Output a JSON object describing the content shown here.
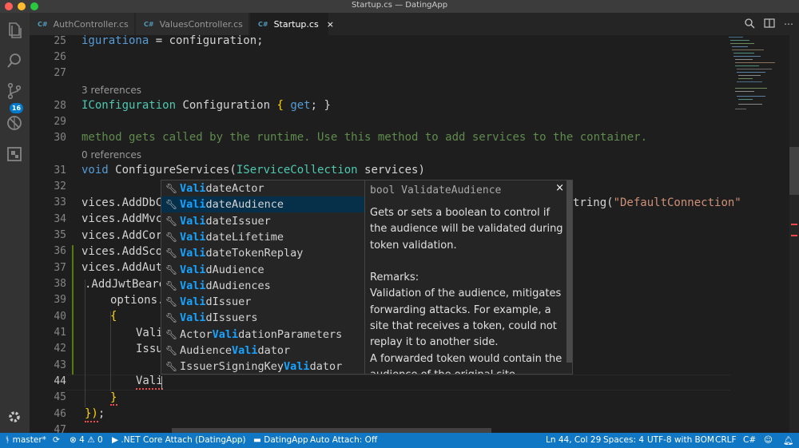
{
  "window": {
    "title": "Startup.cs — DatingApp"
  },
  "activity_bar": {
    "scm_badge": "16"
  },
  "tabs": [
    {
      "icon": "C#",
      "label": "AuthController.cs"
    },
    {
      "icon": "C#",
      "label": "ValuesController.cs"
    },
    {
      "icon": "C#",
      "label": "Startup.cs",
      "close": "×"
    }
  ],
  "editor": {
    "gutter": [
      "25",
      "26",
      "27",
      "28",
      "29",
      "30",
      "31",
      "32",
      "33",
      "34",
      "35",
      "36",
      "37",
      "38",
      "39",
      "40",
      "41",
      "42",
      "43",
      "44",
      "45",
      "46",
      "47"
    ],
    "codelens_28": "3 references",
    "codelens_31": "0 references",
    "lines": {
      "l25": "igurationа = configuration;",
      "l25_a": "igurationа",
      "l25_b": " = configuration;",
      "l28_type": "IConfiguration",
      "l28_mid": " Configuration ",
      "l28_b1": "{ ",
      "l28_get": "get",
      "l28_b2": "; }",
      "l30": "method gets called by the runtime. Use this method to add services to the container.",
      "l31_kw": "void",
      "l31_mid": " ConfigureServices(",
      "l31_type": "IServiceCollection",
      "l31_end": " services)",
      "l33": "vices.AddDbCo",
      "l33_right_a": "tring(",
      "l33_right_str": "\"DefaultConnection\"",
      "l34": "vices.AddMvc(",
      "l35": "vices.AddCors",
      "l36": "vices.AddScop",
      "l37": "vices.AddAuth",
      "l38": ".AddJwtBeare",
      "l39": "options.",
      "l40": "{",
      "l41": "Vali",
      "l42": "Issu",
      "l44": "Vali",
      "l45": "}",
      "l46_a": "})",
      "l46_b": ";"
    }
  },
  "suggest": {
    "items": [
      {
        "pre": "",
        "hl": "Vali",
        "post": "dateActor"
      },
      {
        "pre": "",
        "hl": "Vali",
        "post": "dateAudience"
      },
      {
        "pre": "",
        "hl": "Vali",
        "post": "dateIssuer"
      },
      {
        "pre": "",
        "hl": "Vali",
        "post": "dateLifetime"
      },
      {
        "pre": "",
        "hl": "Vali",
        "post": "dateTokenReplay"
      },
      {
        "pre": "",
        "hl": "Vali",
        "post": "dAudience"
      },
      {
        "pre": "",
        "hl": "Vali",
        "post": "dAudiences"
      },
      {
        "pre": "",
        "hl": "Vali",
        "post": "dIssuer"
      },
      {
        "pre": "",
        "hl": "Vali",
        "post": "dIssuers"
      },
      {
        "pre": "Actor",
        "hl": "Vali",
        "post": "dationParameters"
      },
      {
        "pre": "Audience",
        "hl": "Vali",
        "post": "dator"
      },
      {
        "pre": "IssuerSigningKey",
        "hl": "Vali",
        "post": "dator"
      }
    ],
    "selected_index": 1
  },
  "details": {
    "signature": "bool ValidateAudience",
    "close": "×",
    "summary": "Gets or sets a boolean to control if the audience will be validated during token validation.",
    "remarks_heading": "Remarks:",
    "remarks_1": "Validation of the audience, mitigates forwarding attacks. For example, a site that receives a token, could not replay it to another side.",
    "remarks_2": "A forwarded token would contain the audience of the original site."
  },
  "status_bar": {
    "branch": "master*",
    "errors": "4",
    "warnings": "0",
    "debug": ".NET Core Attach (DatingApp)",
    "folder": "DatingApp",
    "auto_attach": "Auto Attach: Off",
    "position": "Ln 44, Col 29",
    "spaces": "Spaces: 4",
    "encoding": "UTF-8 with BOM",
    "eol": "CRLF",
    "language": "C#"
  },
  "colors": {
    "accent": "#007acc",
    "status_bar": "#0f77c4",
    "match_highlight": "#18a3ff",
    "selected_suggestion": "#062f4a"
  }
}
